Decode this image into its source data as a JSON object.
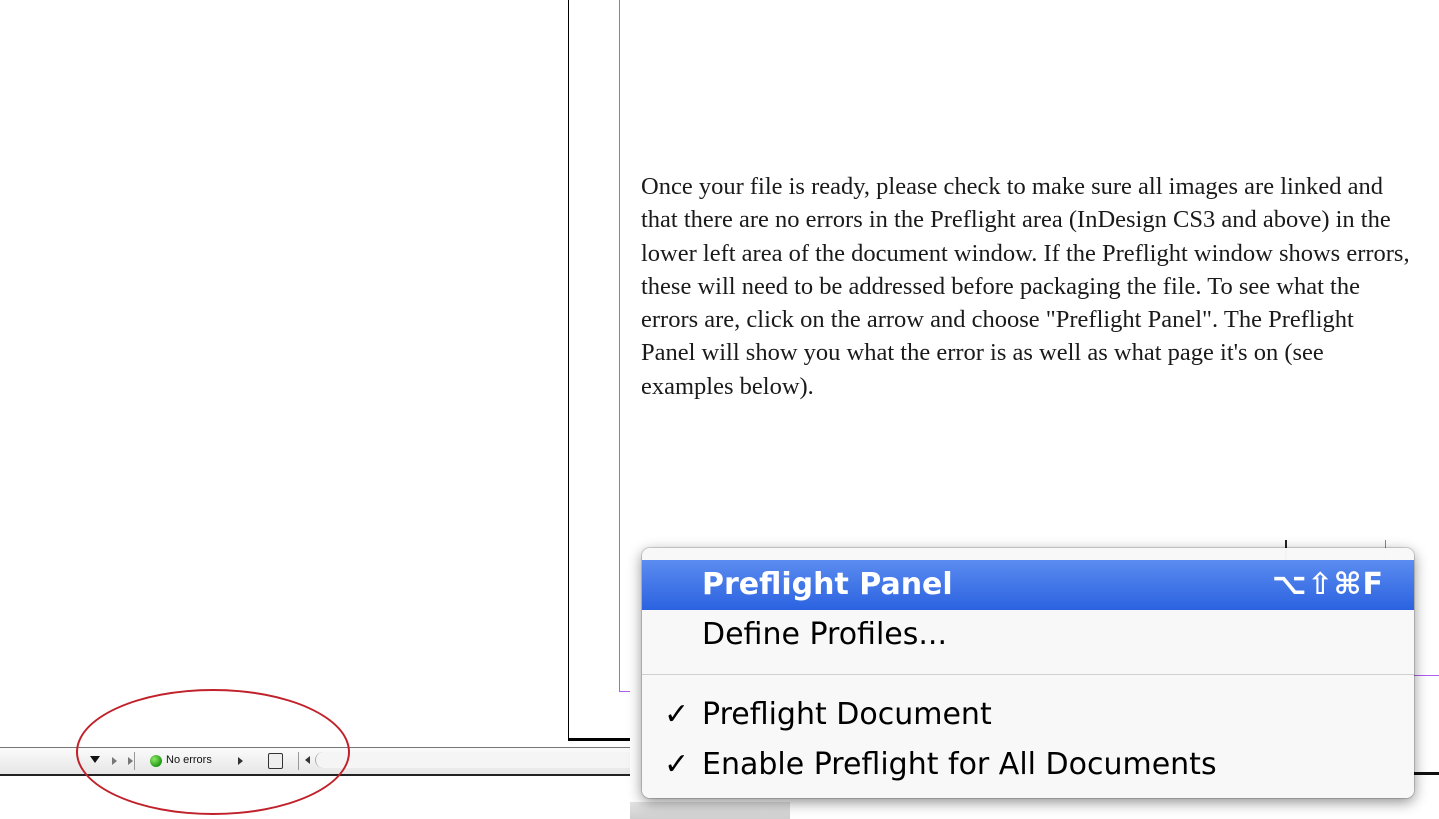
{
  "body_text": "Once your file is ready, please check to make sure all images are linked and that there are no errors in the Preflight area (InDesign CS3 and above) in the lower left area of the document window. If the Preflight window shows errors, these will need to be addressed before packaging the file. To see what the errors are, click on the arrow and choose \"Preflight Panel\". The Preflight Panel will show you what the error is as well as what page it's on (see examples below).",
  "status_bar": {
    "status_text": "No errors",
    "status_color": "#2aa61a"
  },
  "annotation_color": "#c0212a",
  "menu": {
    "items": [
      {
        "label": "Preflight Panel",
        "shortcut": "⌥⇧⌘F",
        "selected": true,
        "checked": false
      },
      {
        "label": "Define Profiles...",
        "shortcut": "",
        "selected": false,
        "checked": false
      },
      {
        "label": "Preflight Document",
        "shortcut": "",
        "selected": false,
        "checked": true
      },
      {
        "label": "Enable Preflight for All Documents",
        "shortcut": "",
        "selected": false,
        "checked": true
      }
    ],
    "check_glyph": "✓",
    "highlight_color": "#2b62e0"
  }
}
